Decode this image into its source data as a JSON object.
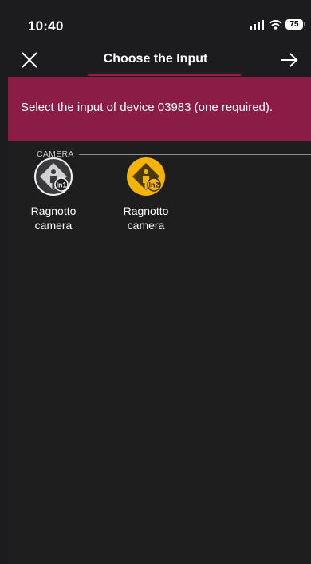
{
  "status_bar": {
    "time": "10:40",
    "battery": "75"
  },
  "nav": {
    "title": "Choose the Input"
  },
  "banner": {
    "message": "Select the input of device 03983 (one required)."
  },
  "section": {
    "label": "CAMERA"
  },
  "inputs": [
    {
      "label": "Ragnotto camera",
      "badge": "In1",
      "color": "#3a3a3c",
      "selected": false
    },
    {
      "label": "Ragnotto camera",
      "badge": "In2",
      "color": "#f5b400",
      "selected": true
    }
  ],
  "icons": [
    "close-icon",
    "arrow-right-icon",
    "signal-icon",
    "wifi-icon",
    "battery-icon",
    "person-icon"
  ]
}
